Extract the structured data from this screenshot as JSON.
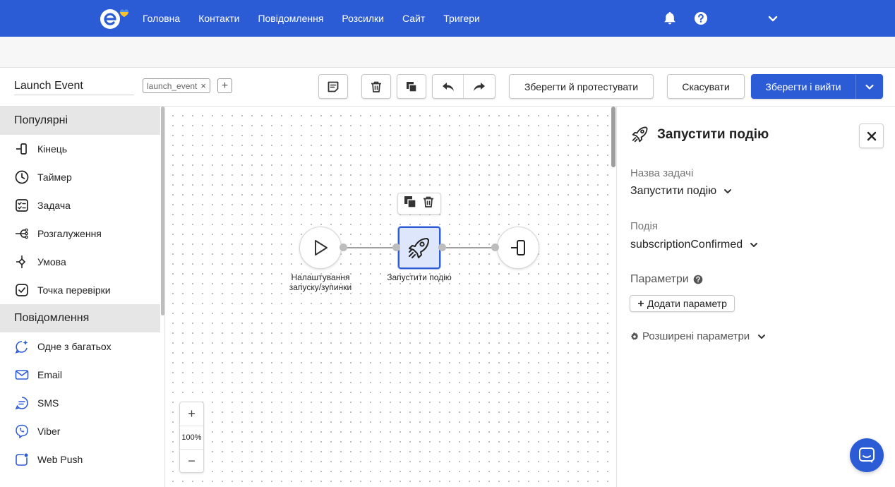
{
  "nav": {
    "items": [
      "Головна",
      "Контакти",
      "Повідомлення",
      "Розсилки",
      "Сайт",
      "Тригери"
    ]
  },
  "toolbar": {
    "title_value": "Launch Event",
    "tag": "launch_event",
    "tag_remove": "×",
    "tag_add": "+",
    "save_test_label": "Зберегти й протестувати",
    "cancel_label": "Скасувати",
    "save_exit_label": "Зберегти і вийти"
  },
  "sidebar": {
    "sections": [
      {
        "header": "Популярні",
        "items": [
          {
            "label": "Кінець",
            "icon": "end-icon"
          },
          {
            "label": "Таймер",
            "icon": "timer-icon"
          },
          {
            "label": "Задача",
            "icon": "task-icon"
          },
          {
            "label": "Розгалуження",
            "icon": "branch-icon"
          },
          {
            "label": "Умова",
            "icon": "condition-icon"
          },
          {
            "label": "Точка перевірки",
            "icon": "checkpoint-icon"
          }
        ]
      },
      {
        "header": "Повідомлення",
        "items": [
          {
            "label": "Одне з багатьох",
            "icon": "sparkle-chat-icon"
          },
          {
            "label": "Email",
            "icon": "email-icon"
          },
          {
            "label": "SMS",
            "icon": "sms-icon"
          },
          {
            "label": "Viber",
            "icon": "viber-icon"
          },
          {
            "label": "Web Push",
            "icon": "web-push-icon"
          }
        ]
      }
    ]
  },
  "canvas": {
    "start_node_label": "Налаштування запуску/зупинки",
    "launch_node_label": "Запустити подію",
    "zoom_in": "+",
    "zoom_level": "100%",
    "zoom_out": "−"
  },
  "panel": {
    "title": "Запустити подію",
    "close": "✕",
    "task_name_label": "Назва задачі",
    "task_name_value": "Запустити подію",
    "event_label": "Подія",
    "event_value": "subscriptionConfirmed",
    "params_label": "Параметри",
    "add_param_label": "Додати параметр",
    "advanced_label": "Розширені параметри"
  },
  "colors": {
    "brand": "#2c5bd6",
    "selected_node_bg": "#dde6fb",
    "sidebar_header_bg": "#e6e6e6"
  }
}
